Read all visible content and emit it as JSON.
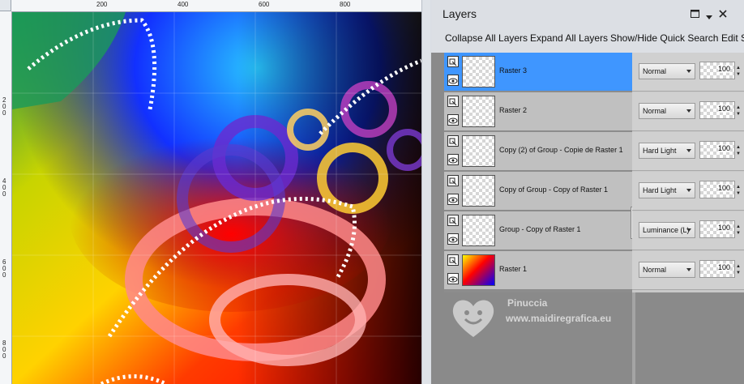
{
  "panel": {
    "title": "Layers",
    "toolbar": {
      "collapse_all": "Collapse All Layers",
      "expand_all": "Expand All Layers",
      "quick_search": "Show/Hide Quick Search",
      "edit": "Edit S"
    }
  },
  "rulers": {
    "top_labels": [
      "200",
      "400",
      "600",
      "800"
    ],
    "left_labels": [
      "200",
      "400",
      "600",
      "800"
    ]
  },
  "layers": [
    {
      "name": "Raster 3",
      "blend_mode": "Normal",
      "opacity": "100",
      "selected": true
    },
    {
      "name": "Raster 2",
      "blend_mode": "Normal",
      "opacity": "100",
      "selected": false
    },
    {
      "name": "Copy (2) of Group - Copie de Raster 1",
      "blend_mode": "Hard Light",
      "opacity": "100",
      "selected": false
    },
    {
      "name": "Copy of Group - Copy of Raster 1",
      "blend_mode": "Hard Light",
      "opacity": "100",
      "selected": false
    },
    {
      "name": "Group - Copy of Raster 1",
      "blend_mode": "Luminance (L)",
      "opacity": "100",
      "selected": false
    },
    {
      "name": "Raster 1",
      "blend_mode": "Normal",
      "opacity": "100",
      "selected": false
    }
  ],
  "watermark": {
    "name": "Pinuccia",
    "url": "www.maidiregrafica.eu"
  },
  "colors": {
    "selected_row": "#3f96ff",
    "row": "#c0c0c0",
    "panel_bg": "#dcdfe4"
  },
  "icons": [
    "restore-icon",
    "dropdown-icon",
    "close-icon",
    "layer-group-icon",
    "visibility-eye-icon"
  ]
}
